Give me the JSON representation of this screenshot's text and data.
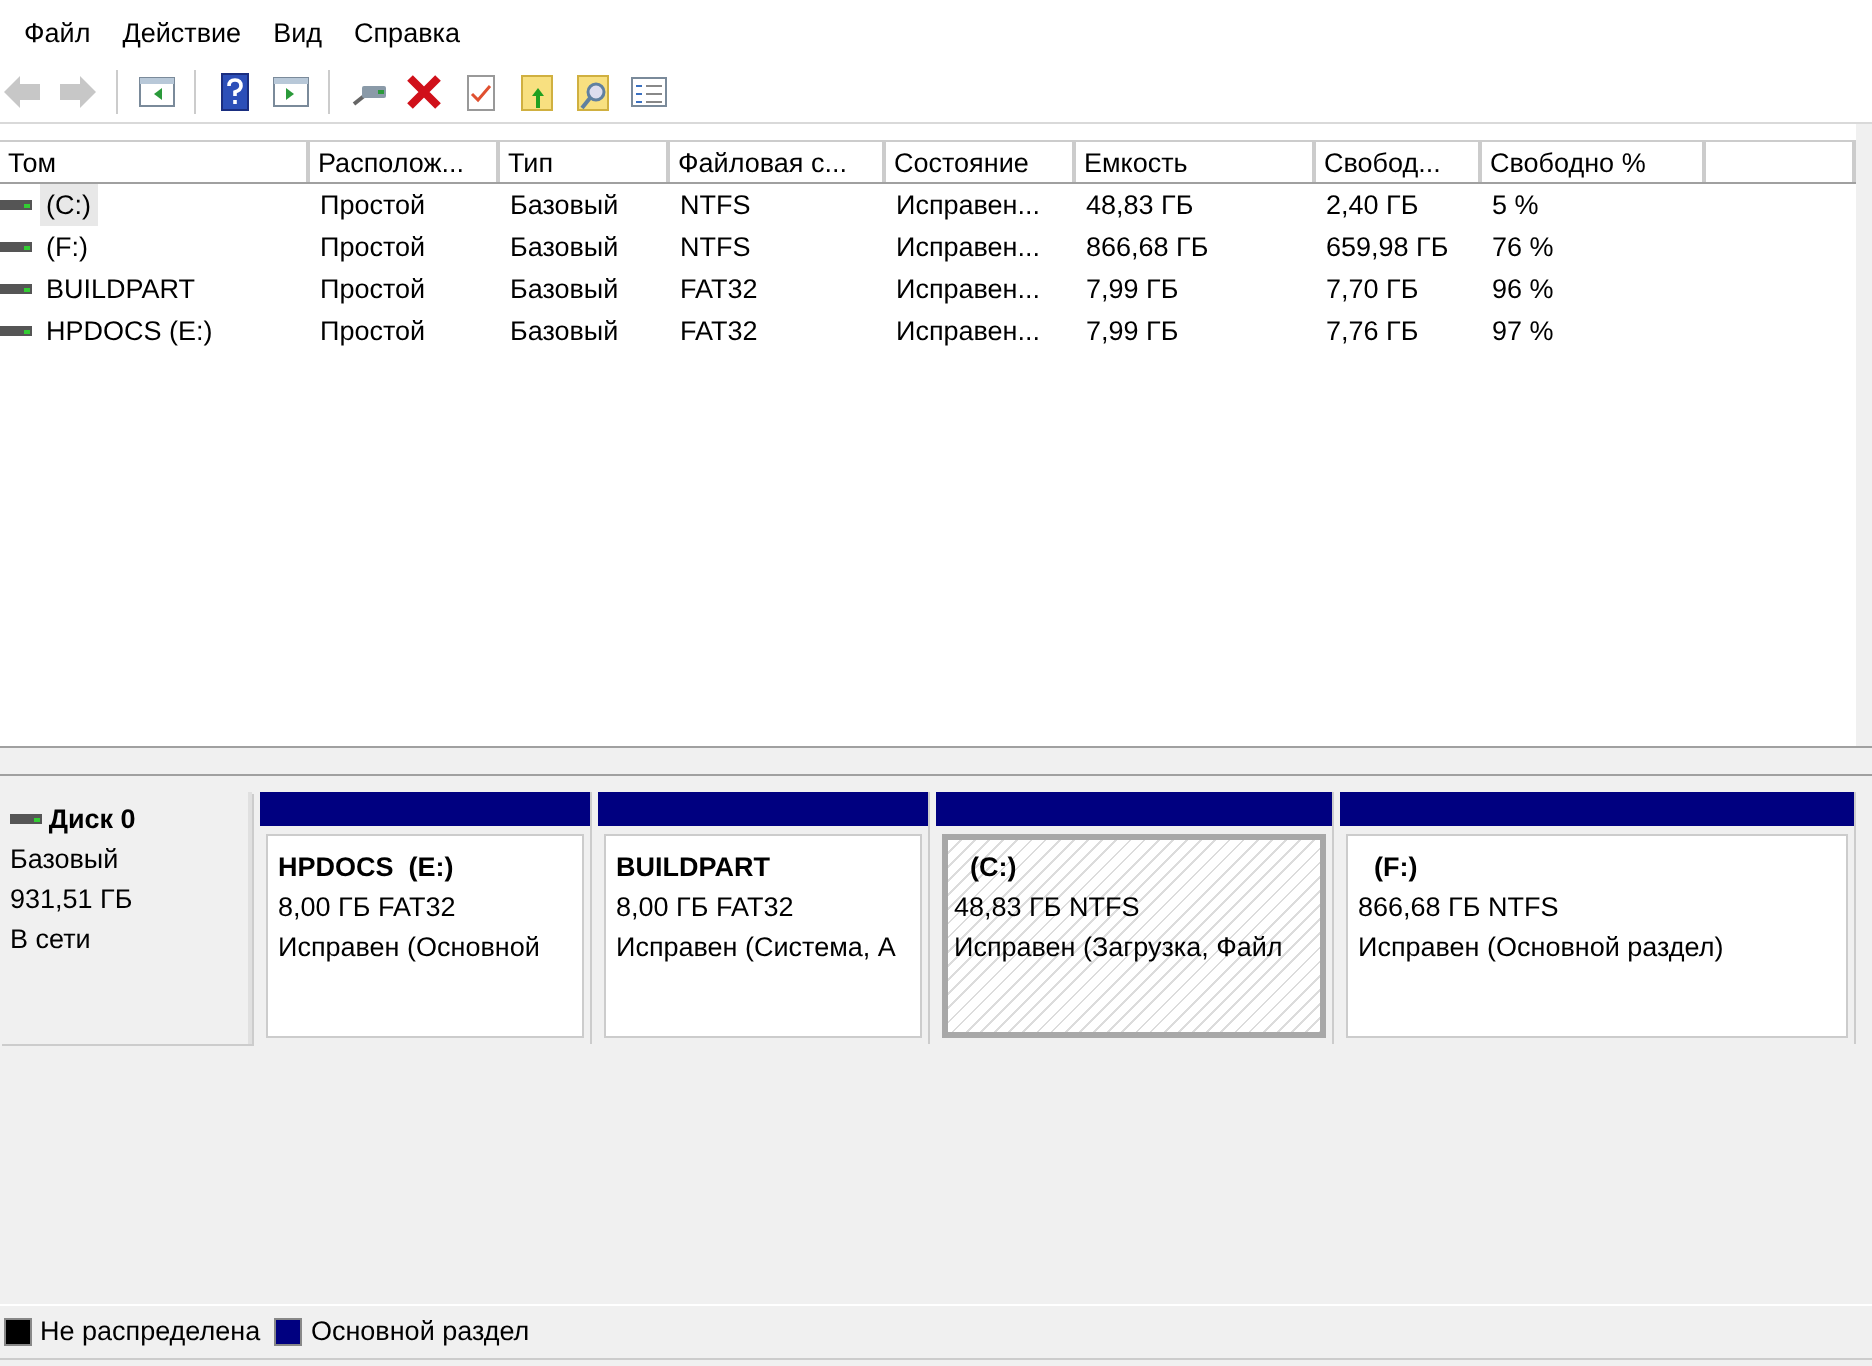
{
  "menu": [
    "Файл",
    "Действие",
    "Вид",
    "Справка"
  ],
  "toolbar": [
    {
      "kind": "back",
      "disabled": true
    },
    {
      "kind": "forward",
      "disabled": true
    },
    {
      "kind": "sep"
    },
    {
      "kind": "tree",
      "disabled": false
    },
    {
      "kind": "sep"
    },
    {
      "kind": "help",
      "disabled": false
    },
    {
      "kind": "pane",
      "disabled": false
    },
    {
      "kind": "sep"
    },
    {
      "kind": "connect",
      "disabled": false
    },
    {
      "kind": "delete",
      "disabled": false
    },
    {
      "kind": "properties",
      "disabled": false
    },
    {
      "kind": "folder_up",
      "disabled": false
    },
    {
      "kind": "folder_search",
      "disabled": false
    },
    {
      "kind": "list",
      "disabled": false
    }
  ],
  "table": {
    "columns": [
      "Том",
      "Располож...",
      "Тип",
      "Файловая с...",
      "Состояние",
      "Емкость",
      "Свобод...",
      "Свободно %"
    ],
    "rows": [
      {
        "selected": true,
        "cells": [
          "(C:)",
          "Простой",
          "Базовый",
          "NTFS",
          "Исправен...",
          "48,83 ГБ",
          "2,40 ГБ",
          "5 %"
        ]
      },
      {
        "selected": false,
        "cells": [
          "(F:)",
          "Простой",
          "Базовый",
          "NTFS",
          "Исправен...",
          "866,68 ГБ",
          "659,98 ГБ",
          "76 %"
        ]
      },
      {
        "selected": false,
        "cells": [
          "BUILDPART",
          "Простой",
          "Базовый",
          "FAT32",
          "Исправен...",
          "7,99 ГБ",
          "7,70 ГБ",
          "96 %"
        ]
      },
      {
        "selected": false,
        "cells": [
          "HPDOCS (E:)",
          "Простой",
          "Базовый",
          "FAT32",
          "Исправен...",
          "7,99 ГБ",
          "7,76 ГБ",
          "97 %"
        ]
      }
    ]
  },
  "disk": {
    "name": "Диск 0",
    "type": "Базовый",
    "size": "931,51 ГБ",
    "status": "В сети",
    "partitions": [
      {
        "name": "HPDOCS  (E:)",
        "size": "8,00 ГБ FAT32",
        "status": "Исправен (Основной",
        "selected": false,
        "color": "#000080"
      },
      {
        "name": "BUILDPART",
        "size": "8,00 ГБ FAT32",
        "status": "Исправен (Система, А",
        "selected": false,
        "color": "#000080"
      },
      {
        "name": "(C:)",
        "size": "48,83 ГБ NTFS",
        "status": "Исправен (Загрузка, Файл",
        "selected": true,
        "color": "#000080"
      },
      {
        "name": "(F:)",
        "size": "866,68 ГБ NTFS",
        "status": "Исправен (Основной раздел)",
        "selected": false,
        "color": "#000080"
      }
    ]
  },
  "legend": [
    {
      "label": "Не распределена",
      "color": "#000000"
    },
    {
      "label": "Основной раздел",
      "color": "#000080"
    }
  ]
}
